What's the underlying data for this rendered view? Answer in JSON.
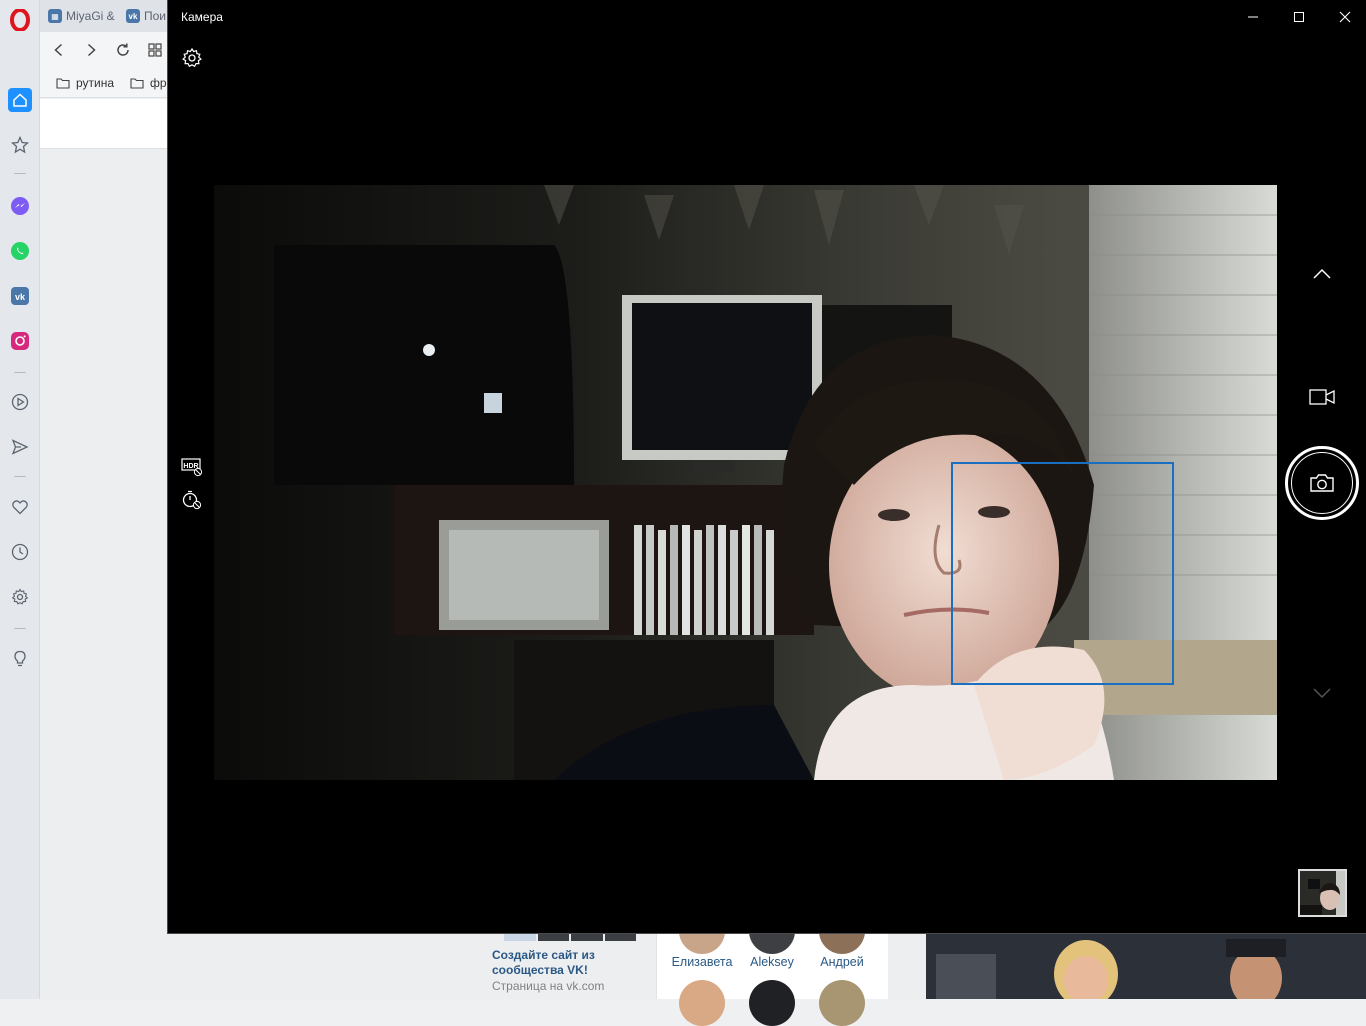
{
  "browser": {
    "tabs": [
      {
        "label": "MiyaGi &",
        "icon": "vk-icon"
      },
      {
        "label": "Пои",
        "icon": "vk-icon"
      }
    ],
    "bookmarks": [
      {
        "label": "рутина",
        "icon": "folder-icon"
      },
      {
        "label": "фр",
        "icon": "folder-icon"
      }
    ]
  },
  "sidebar": {
    "items": [
      "opera-logo",
      "home-icon",
      "star-icon",
      "messenger-icon",
      "whatsapp-icon",
      "vk-icon",
      "instagram-icon",
      "player-icon",
      "send-icon",
      "heart-icon",
      "history-icon",
      "settings-icon",
      "lightbulb-icon"
    ]
  },
  "camera": {
    "title": "Камера",
    "accent_color": "#1a6fc1",
    "controls": [
      "settings-icon",
      "hdr-off-icon",
      "timer-off-icon",
      "chevron-up-icon",
      "video-camera-icon",
      "camera-icon",
      "chevron-down-icon"
    ]
  },
  "vk": {
    "ad_title": "Создайте сайт из сообщества VK!",
    "ad_subtitle": "Страница на vk.com",
    "friends": [
      "Елизавета",
      "Aleksey",
      "Андрей"
    ],
    "link_color": "#2a5885"
  }
}
